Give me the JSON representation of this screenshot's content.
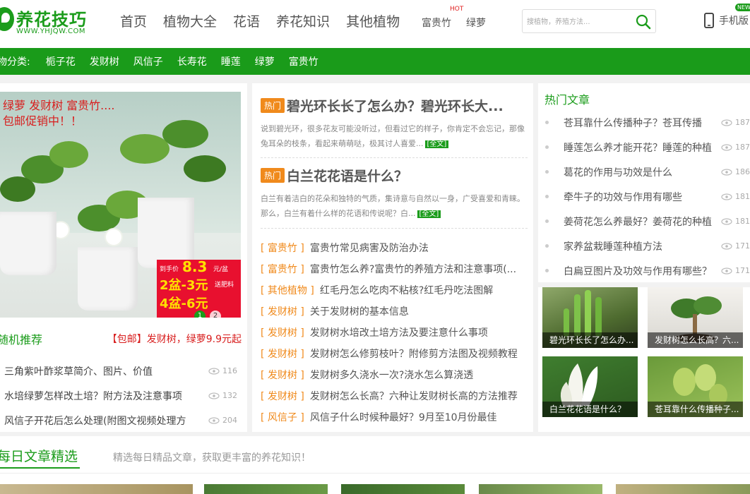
{
  "header": {
    "logo_text": "养花技巧",
    "logo_domain": "WWW.YHJQW.COM",
    "nav": [
      "首页",
      "植物大全",
      "花语",
      "养花知识",
      "其他植物"
    ],
    "sub_nav": [
      "富贵竹",
      "绿萝"
    ],
    "hot_tag": "HOT",
    "search_placeholder": "搜植物，养殖方法...",
    "mobile_label": "手机版",
    "new_tag": "NEW"
  },
  "category_bar": {
    "title": "物分类:",
    "items": [
      "栀子花",
      "发财树",
      "风信子",
      "长寿花",
      "睡莲",
      "绿萝",
      "富贵竹"
    ]
  },
  "promo": {
    "line1": "绿萝 发财树 富贵竹....",
    "line2": "包邮促销中！！",
    "price_label": "到手价",
    "price": "8.3",
    "price_unit": "元/盆",
    "deal1": "2盆-3元",
    "deal2": "4盆-6元",
    "slides": [
      "1",
      "2"
    ],
    "gift": "送肥料"
  },
  "recommend": {
    "title": "随机推荐",
    "promo_text": "【包邮】发财树，绿萝9.9元起",
    "items": [
      {
        "title": "三角紫叶酢浆草简介、图片、价值",
        "views": "116"
      },
      {
        "title": "水培绿萝怎样改土培？附方法及注意事项",
        "views": "132"
      },
      {
        "title": "风信子开花后怎么处理(附图文视频处理方",
        "views": "204"
      }
    ]
  },
  "features": [
    {
      "badge": "热门",
      "title": "碧光环长长了怎么办？碧光环长大...",
      "desc": "说到碧光环，很多花友可能没听过，但看过它的样子，你肯定不会忘记，那像兔耳朵的枝条，看起来萌萌哒，极其讨人喜爱...",
      "link": "[全文]"
    },
    {
      "badge": "热门",
      "title": "白兰花花语是什么？",
      "desc": "白兰有着洁白的花朵和独特的气质，集诗意与自然以一身，广受喜爱和青睐。那么，白兰有着什么样的花语和传说呢？白...",
      "link": "[全文]"
    }
  ],
  "news": [
    {
      "cat": "[ 富贵竹 ]",
      "title": "富贵竹常见病害及防治办法"
    },
    {
      "cat": "[ 富贵竹 ]",
      "title": "富贵竹怎么养?富贵竹的养殖方法和注意事项(..."
    },
    {
      "cat": "[ 其他植物 ]",
      "title": "红毛丹怎么吃肉不粘核?红毛丹吃法图解"
    },
    {
      "cat": "[ 发财树 ]",
      "title": "关于发财树的基本信息"
    },
    {
      "cat": "[ 发财树 ]",
      "title": "发财树水培改土培方法及要注意什么事项"
    },
    {
      "cat": "[ 发财树 ]",
      "title": "发财树怎么修剪枝叶？附修剪方法图及视频教程"
    },
    {
      "cat": "[ 发财树 ]",
      "title": "发财树多久浇水一次?浇水怎么算浇透"
    },
    {
      "cat": "[ 发财树 ]",
      "title": "发财树怎么长高？六种让发财树长高的方法推荐"
    },
    {
      "cat": "[ 风信子 ]",
      "title": "风信子什么时候种最好？9月至10月份最佳"
    }
  ],
  "hot_articles": {
    "title": "热门文章",
    "items": [
      {
        "title": "苍耳靠什么传播种子？苍耳传播",
        "views": "187"
      },
      {
        "title": "睡莲怎么养才能开花？睡莲的种植",
        "views": "187"
      },
      {
        "title": "葛花的作用与功效是什么",
        "views": "186"
      },
      {
        "title": "牵牛子的功效与作用有哪些",
        "views": "181"
      },
      {
        "title": "姜荷花怎么养最好？姜荷花的种植",
        "views": "181"
      },
      {
        "title": "家养盆栽睡莲种植方法",
        "views": "171"
      },
      {
        "title": "白扁豆图片及功效与作用有哪些？",
        "views": "171"
      }
    ]
  },
  "thumbs": [
    {
      "caption": "碧光环长长了怎么办..."
    },
    {
      "caption": "发财树怎么长高？六..."
    },
    {
      "caption": "白兰花花语是什么？"
    },
    {
      "caption": "苍耳靠什么传播种子..."
    }
  ],
  "daily": {
    "title": "每日文章精选",
    "subtitle": "精选每日精品文章，获取更丰富的养花知识！"
  },
  "colors": {
    "brand_green": "#1b9c1b",
    "hot_orange": "#f08a1c",
    "promo_red": "#d81e1e"
  }
}
